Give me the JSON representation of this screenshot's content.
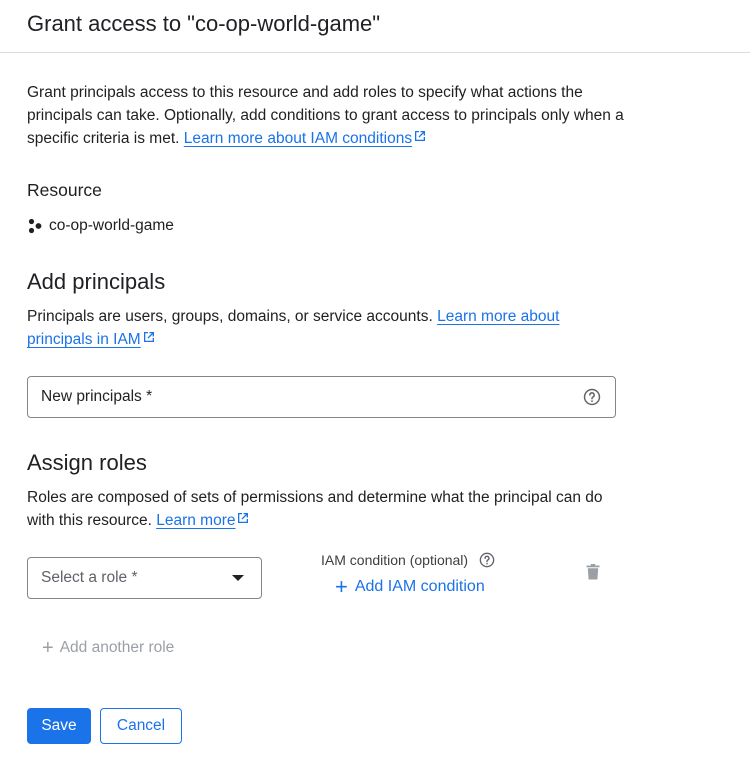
{
  "dialog": {
    "title": "Grant access to \"co-op-world-game\"",
    "intro_text": "Grant principals access to this resource and add roles to specify what actions the principals can take. Optionally, add conditions to grant access to principals only when a specific criteria is met. ",
    "intro_link": "Learn more about IAM conditions"
  },
  "resource": {
    "label": "Resource",
    "name": "co-op-world-game",
    "icon": "resource-icon"
  },
  "principals": {
    "title": "Add principals",
    "description": "Principals are users, groups, domains, or service accounts. ",
    "link": "Learn more about principals in IAM",
    "field_placeholder": "New principals *",
    "field_value": ""
  },
  "roles": {
    "title": "Assign roles",
    "description": "Roles are composed of sets of permissions and determine what the principal can do with this resource. ",
    "link": "Learn more",
    "select_placeholder": "Select a role *",
    "condition_label": "IAM condition (optional)",
    "add_condition": "Add IAM condition",
    "add_another_role": "Add another role"
  },
  "actions": {
    "save": "Save",
    "cancel": "Cancel"
  },
  "colors": {
    "accent": "#1a73e8",
    "text": "#202124",
    "border": "#80868b",
    "disabled": "#9aa0a6"
  }
}
